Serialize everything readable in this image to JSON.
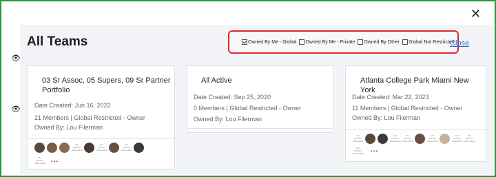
{
  "page": {
    "title": "All Teams",
    "close_link": "Close"
  },
  "filters": [
    {
      "label": "Owned By Me - Global",
      "checked": true
    },
    {
      "label": "Owned By Me - Private",
      "checked": false
    },
    {
      "label": "Owned By Other",
      "checked": false
    },
    {
      "label": "Global Not Restricted",
      "checked": false
    }
  ],
  "cards": [
    {
      "title": "03 Sr Assoc, 05 Supers, 09 Sr Partner Portfolio",
      "date_created": "Date Created:  Jun 16, 2022",
      "members": "21 Members | Global Restricted - Owner",
      "owned_by": "Owned By:  Lou Filerman",
      "more": "..."
    },
    {
      "title": "All Active",
      "date_created": "Date Created:  Sep 25, 2020",
      "members": "0 Members | Global Restricted - Owner",
      "owned_by": "Owned By:  Lou Filerman",
      "more": ""
    },
    {
      "title": "Atlanta College Park Miami New York",
      "date_created": "Date Created:  Mar 22, 2023",
      "members": "11 Members | Global Restricted - Owner",
      "owned_by": "Owned By:  Lou Filerman",
      "more": "..."
    }
  ],
  "no_photo_text": "NO PHOTO AVAILABLE"
}
